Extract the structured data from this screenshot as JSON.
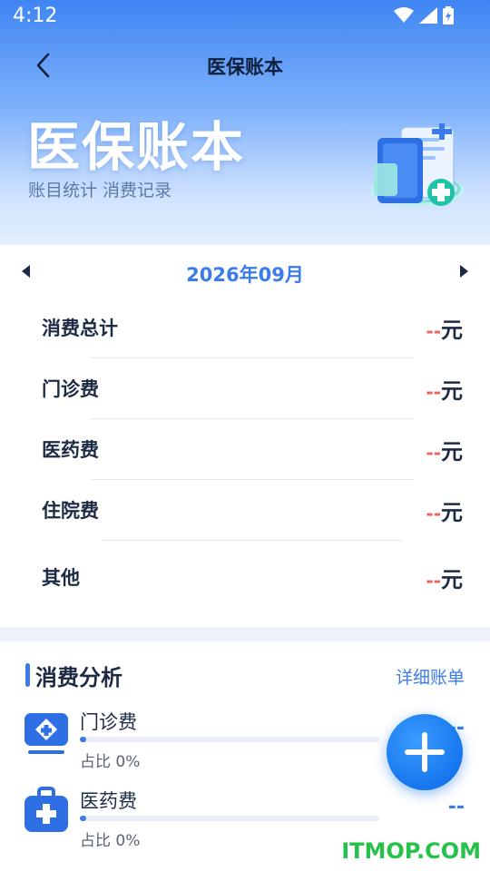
{
  "status": {
    "time": "4:12"
  },
  "nav": {
    "title": "医保账本"
  },
  "hero": {
    "title": "医保账本",
    "subtitle": "账目统计 消费记录"
  },
  "month": {
    "label": "2026年09月"
  },
  "summary": [
    {
      "label": "消费总计",
      "dash": "--",
      "unit": "元"
    },
    {
      "label": "门诊费",
      "dash": "--",
      "unit": "元"
    },
    {
      "label": "医药费",
      "dash": "--",
      "unit": "元"
    },
    {
      "label": "住院费",
      "dash": "--",
      "unit": "元"
    },
    {
      "label": "其他",
      "dash": "--",
      "unit": "元"
    }
  ],
  "analysis": {
    "title": "消费分析",
    "link": "详细账单",
    "items": [
      {
        "name": "门诊费",
        "pct": "占比 0%",
        "value": "--",
        "fraction": 0.02,
        "icon": "clinic-icon"
      },
      {
        "name": "医药费",
        "pct": "占比 0%",
        "value": "--",
        "fraction": 0.02,
        "icon": "medicine-kit-icon"
      },
      {
        "name": "住院费",
        "pct": "",
        "value": "",
        "fraction": 0,
        "icon": "hospital-icon"
      }
    ]
  },
  "fab": {
    "icon": "plus-icon"
  },
  "watermark": {
    "text": "ITMOP.COM"
  },
  "colors": {
    "accent": "#3b7bea",
    "dash": "#f0625a",
    "header_top": "#3f85f3"
  }
}
